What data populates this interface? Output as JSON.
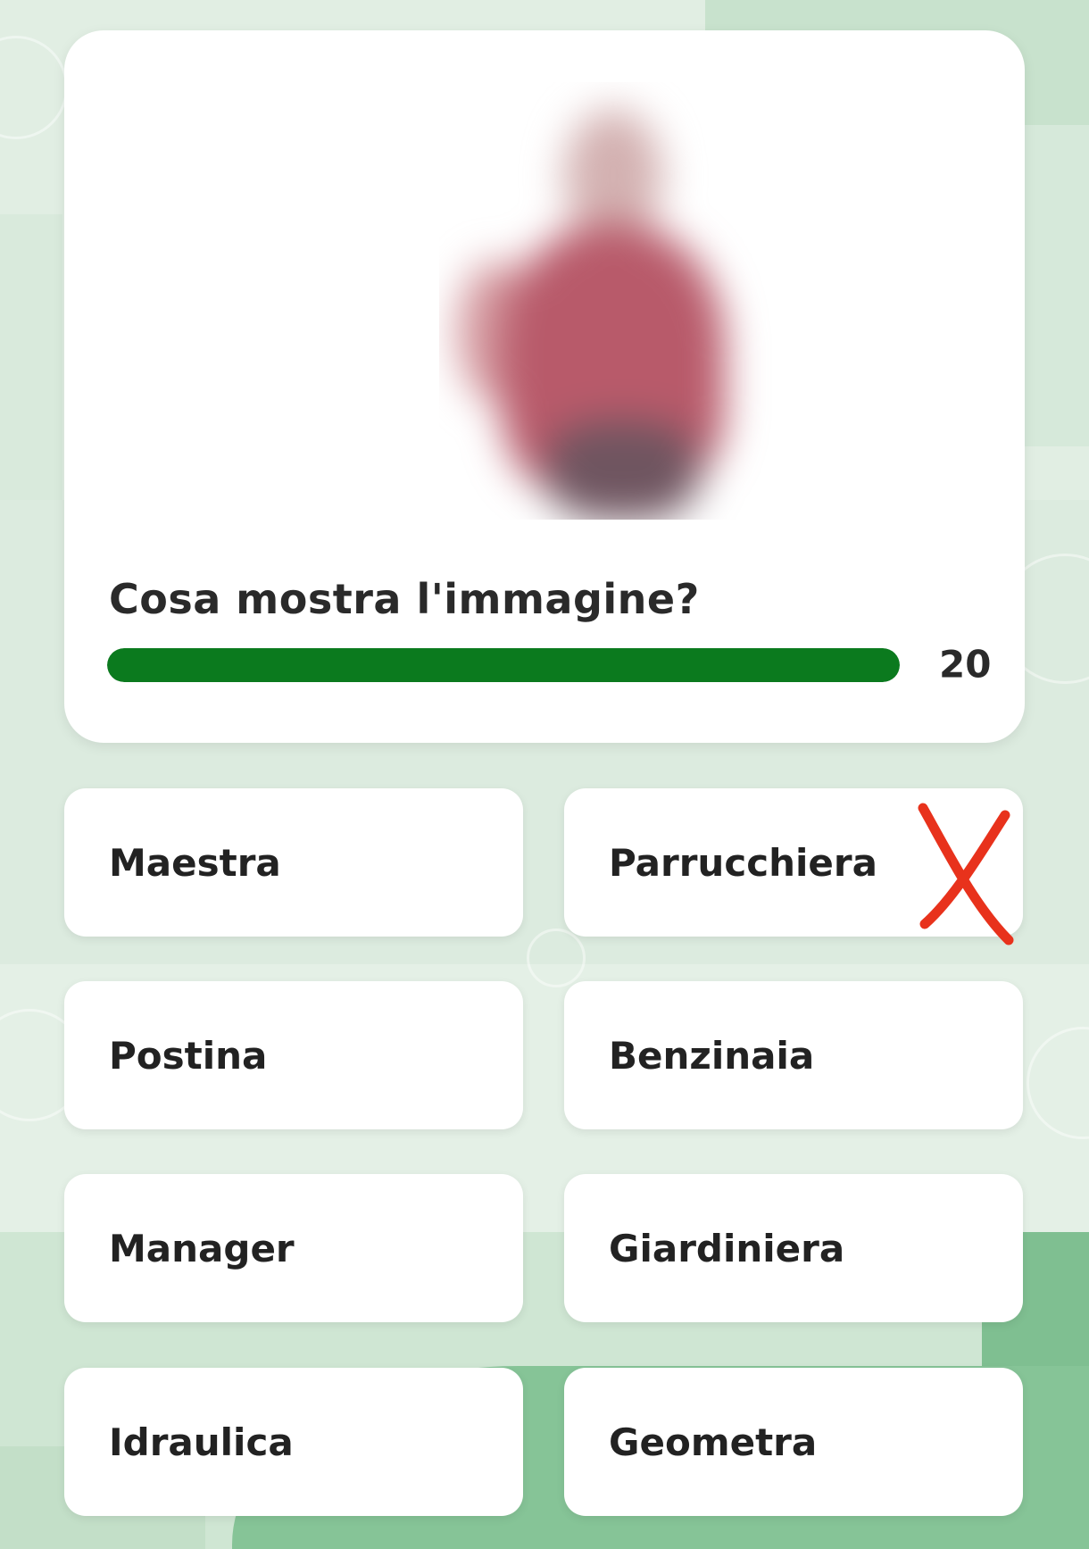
{
  "quiz": {
    "question": "Cosa mostra l'immagine?",
    "timer": {
      "value": "20",
      "fraction_remaining": 1.0,
      "color": "#0b7a1e"
    },
    "image": {
      "state": "blurred"
    }
  },
  "answers": [
    {
      "label": "Maestra"
    },
    {
      "label": "Parrucchiera",
      "marked_wrong": true
    },
    {
      "label": "Postina"
    },
    {
      "label": "Benzinaia"
    },
    {
      "label": "Manager"
    },
    {
      "label": "Giardiniera"
    },
    {
      "label": "Idraulica"
    },
    {
      "label": "Geometra"
    }
  ],
  "annotations": {
    "wrong_mark_icon": "cross-mark-icon",
    "wrong_mark_color": "#e8321c"
  }
}
